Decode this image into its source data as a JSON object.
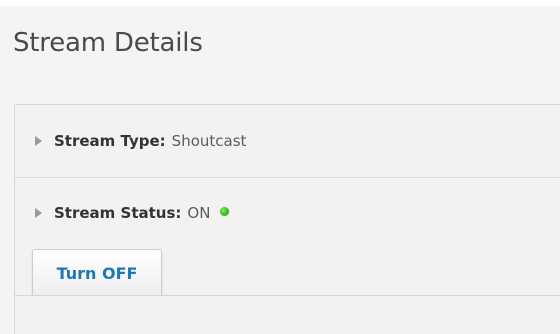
{
  "page": {
    "title": "Stream Details"
  },
  "stream_type": {
    "label": "Stream Type:",
    "value": "Shoutcast"
  },
  "stream_status": {
    "label": "Stream Status:",
    "value": "ON",
    "indicator_color": "#2fc414"
  },
  "actions": {
    "turn_off_label": "Turn OFF",
    "button_text_color": "#1e78b4"
  },
  "icons": {
    "expand": "triangle-right-icon",
    "status": "status-dot-icon"
  }
}
